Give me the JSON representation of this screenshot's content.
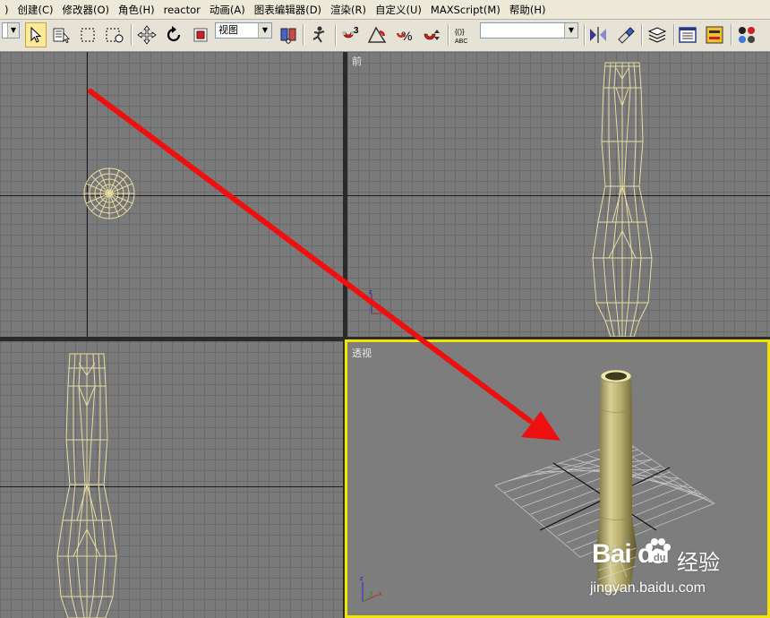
{
  "menu": {
    "items": [
      ")",
      "创建(C)",
      "修改器(O)",
      "角色(H)",
      "reactor",
      "动画(A)",
      "图表编辑器(D)",
      "渲染(R)",
      "自定义(U)",
      "MAXScript(M)",
      "帮助(H)"
    ]
  },
  "toolbar": {
    "view_dropdown": "视图",
    "snap_angle_icon": "3",
    "named_selection_value": ""
  },
  "viewports": {
    "top_label": "",
    "front_label": "前",
    "left_label": "",
    "perspective_label": "透视"
  },
  "watermark": {
    "logo_text": "Bai du",
    "brand_cn": "经验",
    "url": "jingyan.baidu.com"
  },
  "colors": {
    "wireframe": "#e8dca0",
    "active_viewport_border": "#f2e600",
    "arrow": "#ee1010",
    "object_shaded": "#b8ad6e"
  }
}
